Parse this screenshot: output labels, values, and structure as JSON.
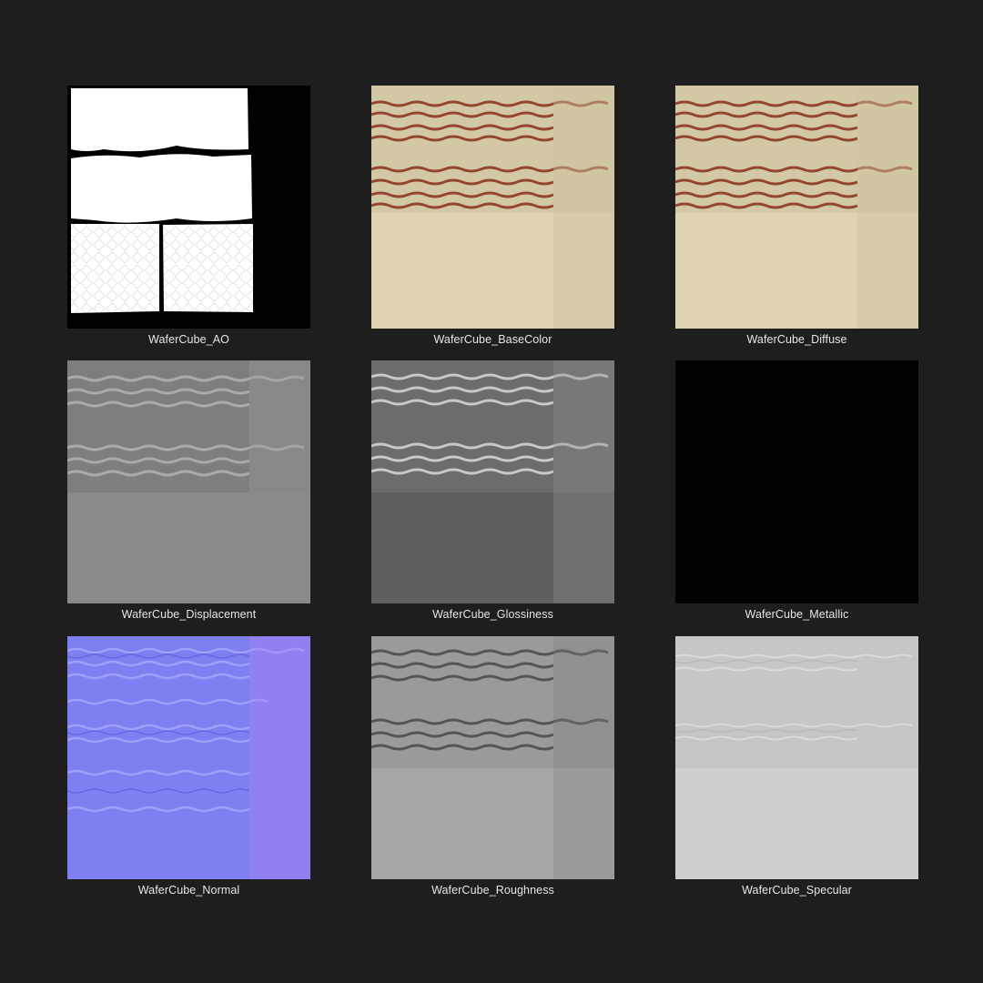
{
  "textures": [
    {
      "id": "ao",
      "label": "WaferCube_AO",
      "icon": "ao-map-thumbnail"
    },
    {
      "id": "basecolor",
      "label": "WaferCube_BaseColor",
      "icon": "base-color-map-thumbnail"
    },
    {
      "id": "diffuse",
      "label": "WaferCube_Diffuse",
      "icon": "diffuse-map-thumbnail"
    },
    {
      "id": "displacement",
      "label": "WaferCube_Displacement",
      "icon": "displacement-map-thumbnail"
    },
    {
      "id": "glossiness",
      "label": "WaferCube_Glossiness",
      "icon": "glossiness-map-thumbnail"
    },
    {
      "id": "metallic",
      "label": "WaferCube_Metallic",
      "icon": "metallic-map-thumbnail"
    },
    {
      "id": "normal",
      "label": "WaferCube_Normal",
      "icon": "normal-map-thumbnail"
    },
    {
      "id": "roughness",
      "label": "WaferCube_Roughness",
      "icon": "roughness-map-thumbnail"
    },
    {
      "id": "specular",
      "label": "WaferCube_Specular",
      "icon": "specular-map-thumbnail"
    }
  ],
  "colors": {
    "background": "#1e1e1e",
    "caption": "#e6e6e6"
  }
}
